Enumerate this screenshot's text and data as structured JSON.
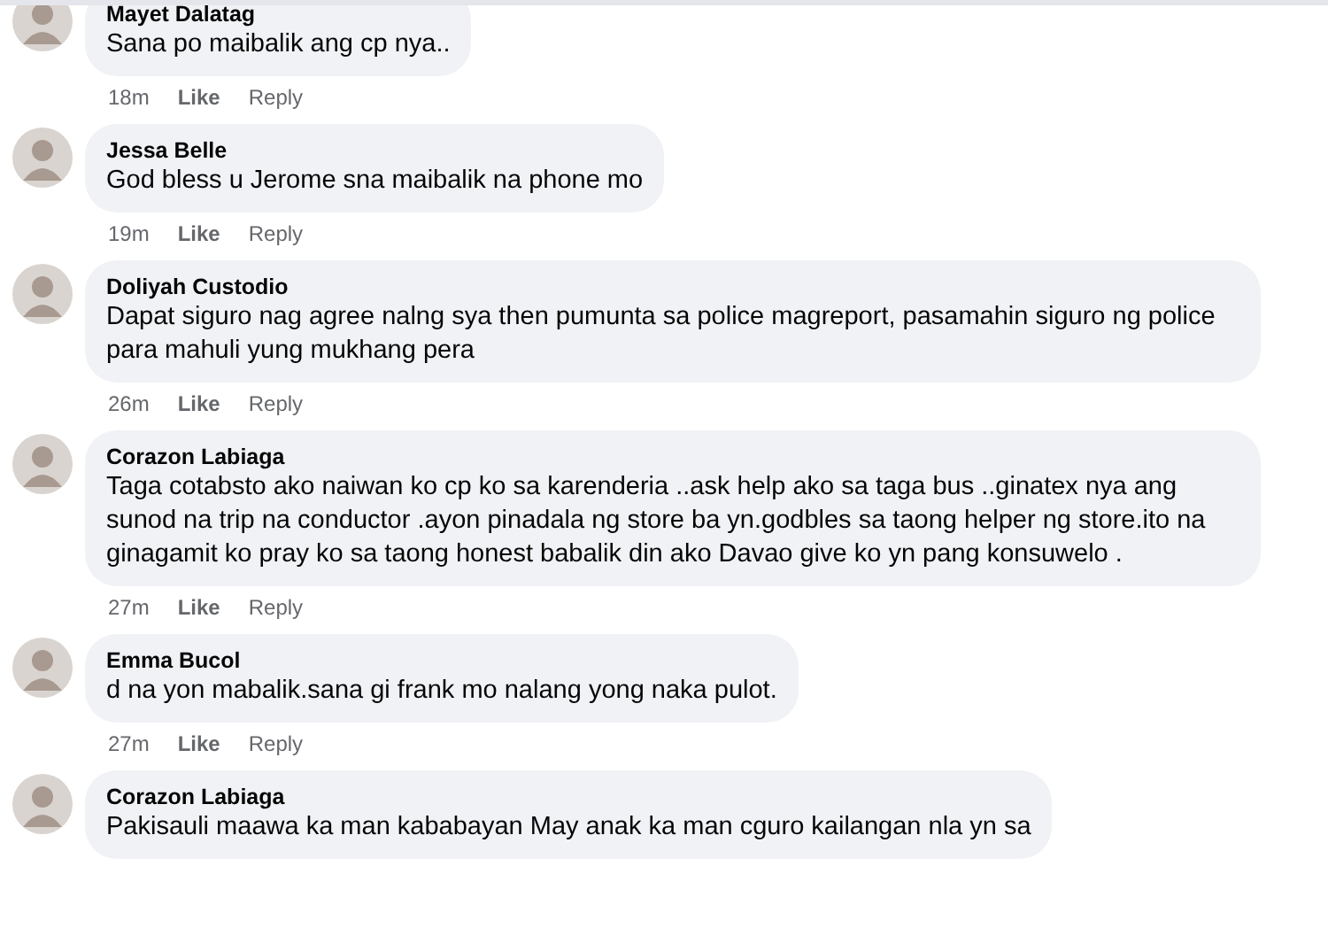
{
  "comments": [
    {
      "author": "Mayet Dalatag",
      "text": "Sana po maibalik ang cp nya..",
      "time": "18m",
      "like": "Like",
      "reply": "Reply"
    },
    {
      "author": "Jessa Belle",
      "text": "God bless u Jerome sna maibalik na phone mo",
      "time": "19m",
      "like": "Like",
      "reply": "Reply"
    },
    {
      "author": "Doliyah Custodio",
      "text": "Dapat siguro nag agree nalng sya then pumunta sa police magreport, pasamahin siguro ng police para mahuli yung mukhang pera",
      "time": "26m",
      "like": "Like",
      "reply": "Reply"
    },
    {
      "author": "Corazon Labiaga",
      "text": "Taga cotabsto ako naiwan ko cp ko sa karenderia ..ask help ako sa taga bus ..ginatex nya ang sunod na trip na conductor .ayon pinadala ng store ba yn.godbles sa taong helper ng store.ito na ginagamit ko pray ko sa taong honest babalik din ako Davao give ko yn pang konsuwelo .",
      "time": "27m",
      "like": "Like",
      "reply": "Reply"
    },
    {
      "author": "Emma Bucol",
      "text": "d na yon mabalik.sana gi frank mo nalang yong naka pulot.",
      "time": "27m",
      "like": "Like",
      "reply": "Reply"
    },
    {
      "author": "Corazon Labiaga",
      "text": "Pakisauli maawa ka man kababayan May anak ka man cguro kailangan nla yn sa"
    }
  ]
}
